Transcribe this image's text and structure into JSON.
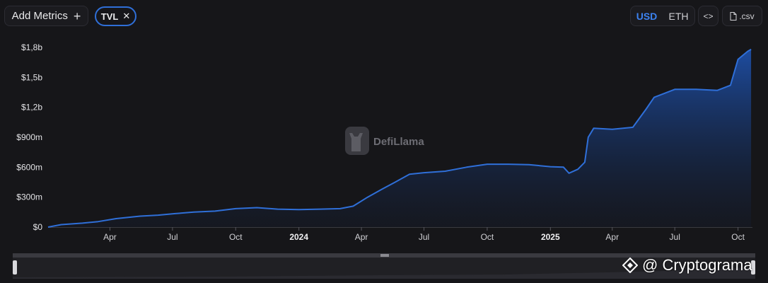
{
  "toolbar": {
    "add_metrics_label": "Add Metrics",
    "metric_chip": "TVL",
    "currency_usd": "USD",
    "currency_eth": "ETH",
    "embed_label": "<>",
    "csv_label": ".csv"
  },
  "colors": {
    "background": "#161619",
    "line": "#2f6fd8",
    "accent": "#3c82f0"
  },
  "brand_watermark": "DefiLlama",
  "corner_watermark": "@ Cryptograma",
  "chart_data": {
    "type": "area",
    "series": [
      {
        "name": "TVL",
        "points": [
          [
            "2023-01-01",
            0
          ],
          [
            "2023-01-20",
            25000000
          ],
          [
            "2023-02-20",
            40000000
          ],
          [
            "2023-03-15",
            55000000
          ],
          [
            "2023-04-10",
            85000000
          ],
          [
            "2023-05-15",
            110000000
          ],
          [
            "2023-06-10",
            120000000
          ],
          [
            "2023-07-05",
            135000000
          ],
          [
            "2023-08-01",
            150000000
          ],
          [
            "2023-09-01",
            160000000
          ],
          [
            "2023-10-01",
            185000000
          ],
          [
            "2023-11-01",
            195000000
          ],
          [
            "2023-12-01",
            180000000
          ],
          [
            "2024-01-01",
            175000000
          ],
          [
            "2024-02-01",
            180000000
          ],
          [
            "2024-03-01",
            185000000
          ],
          [
            "2024-03-20",
            210000000
          ],
          [
            "2024-04-10",
            300000000
          ],
          [
            "2024-05-01",
            380000000
          ],
          [
            "2024-05-20",
            450000000
          ],
          [
            "2024-06-10",
            530000000
          ],
          [
            "2024-07-01",
            545000000
          ],
          [
            "2024-08-01",
            560000000
          ],
          [
            "2024-09-01",
            600000000
          ],
          [
            "2024-10-01",
            630000000
          ],
          [
            "2024-11-01",
            630000000
          ],
          [
            "2024-12-01",
            625000000
          ],
          [
            "2025-01-01",
            605000000
          ],
          [
            "2025-01-20",
            600000000
          ],
          [
            "2025-01-28",
            540000000
          ],
          [
            "2025-02-10",
            580000000
          ],
          [
            "2025-02-20",
            650000000
          ],
          [
            "2025-02-25",
            900000000
          ],
          [
            "2025-03-05",
            990000000
          ],
          [
            "2025-04-01",
            980000000
          ],
          [
            "2025-05-01",
            1000000000
          ],
          [
            "2025-05-20",
            1180000000
          ],
          [
            "2025-06-01",
            1300000000
          ],
          [
            "2025-07-01",
            1380000000
          ],
          [
            "2025-08-01",
            1380000000
          ],
          [
            "2025-09-01",
            1370000000
          ],
          [
            "2025-09-20",
            1420000000
          ],
          [
            "2025-10-01",
            1680000000
          ],
          [
            "2025-10-15",
            1760000000
          ],
          [
            "2025-10-20",
            1780000000
          ]
        ]
      }
    ],
    "y_ticks": [
      "$0",
      "$300m",
      "$600m",
      "$900m",
      "$1,2b",
      "$1,5b",
      "$1,8b"
    ],
    "y_tick_values": [
      0,
      300000000,
      600000000,
      900000000,
      1200000000,
      1500000000,
      1800000000
    ],
    "ylim": [
      0,
      1800000000
    ],
    "x_ticks": [
      {
        "label": "Apr",
        "date": "2023-04-01"
      },
      {
        "label": "Jul",
        "date": "2023-07-01"
      },
      {
        "label": "Oct",
        "date": "2023-10-01"
      },
      {
        "label": "2024",
        "date": "2024-01-01",
        "bold": true
      },
      {
        "label": "Apr",
        "date": "2024-04-01"
      },
      {
        "label": "Jul",
        "date": "2024-07-01"
      },
      {
        "label": "Oct",
        "date": "2024-10-01"
      },
      {
        "label": "2025",
        "date": "2025-01-01",
        "bold": true
      },
      {
        "label": "Apr",
        "date": "2025-04-01"
      },
      {
        "label": "Jul",
        "date": "2025-07-01"
      },
      {
        "label": "Oct",
        "date": "2025-10-01"
      }
    ],
    "xlim": [
      "2023-01-01",
      "2025-10-22"
    ],
    "grid": false
  }
}
